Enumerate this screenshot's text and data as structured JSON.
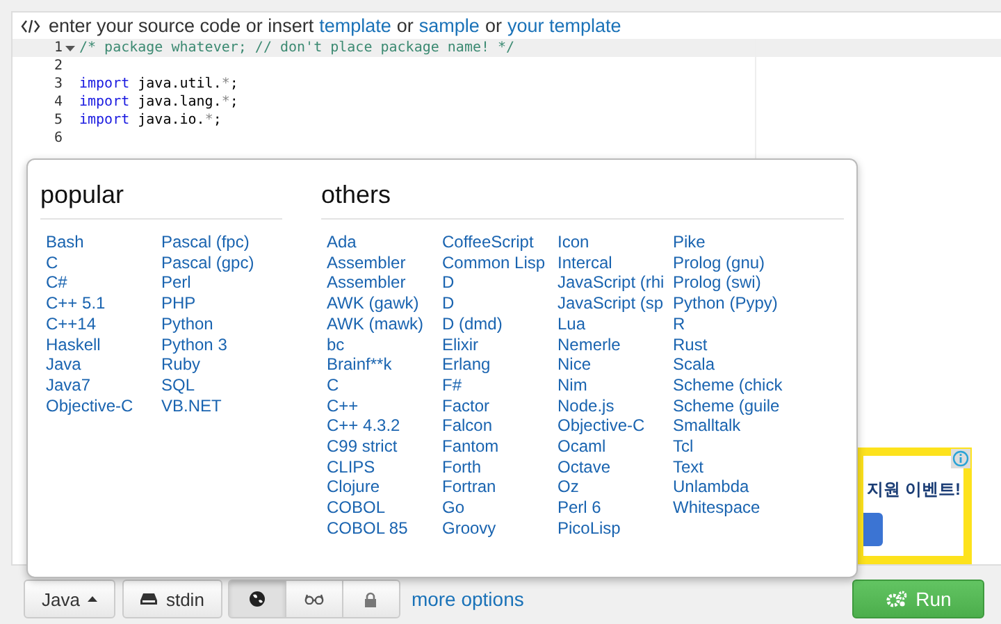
{
  "header": {
    "parts": [
      {
        "kind": "text",
        "text": "enter your source code or insert"
      },
      {
        "kind": "link",
        "text": "template"
      },
      {
        "kind": "text",
        "text": "or"
      },
      {
        "kind": "link",
        "text": "sample"
      },
      {
        "kind": "text",
        "text": "or"
      },
      {
        "kind": "link",
        "text": "your template"
      }
    ]
  },
  "code_lines": [
    {
      "number": "1",
      "foldable": true,
      "active": true,
      "kind": "comment",
      "text": "/* package whatever; // don't place package name! */"
    },
    {
      "number": "2",
      "foldable": false,
      "active": false,
      "kind": "blank"
    },
    {
      "number": "3",
      "foldable": false,
      "active": false,
      "kind": "import",
      "keyword": "import",
      "text": "java.util.",
      "star": "*",
      "end": ";"
    },
    {
      "number": "4",
      "foldable": false,
      "active": false,
      "kind": "import",
      "keyword": "import",
      "text": "java.lang.",
      "star": "*",
      "end": ";"
    },
    {
      "number": "5",
      "foldable": false,
      "active": false,
      "kind": "import",
      "keyword": "import",
      "text": "java.io.",
      "star": "*",
      "end": ";"
    },
    {
      "number": "6",
      "foldable": false,
      "active": false,
      "kind": "blank"
    }
  ],
  "language_menu": {
    "popular": {
      "title": "popular",
      "columns": [
        [
          "Bash",
          "C",
          "C#",
          "C++ 5.1",
          "C++14",
          "Haskell",
          "Java",
          "Java7",
          "Objective-C"
        ],
        [
          "Pascal (fpc)",
          "Pascal (gpc)",
          "Perl",
          "PHP",
          "Python",
          "Python 3",
          "Ruby",
          "SQL",
          "VB.NET"
        ]
      ]
    },
    "others": {
      "title": "others",
      "columns": [
        [
          "Ada",
          "Assembler",
          "Assembler",
          "AWK (gawk)",
          "AWK (mawk)",
          "bc",
          "Brainf**k",
          "C",
          "C++",
          "C++ 4.3.2",
          "C99 strict",
          "CLIPS",
          "Clojure",
          "COBOL",
          "COBOL 85"
        ],
        [
          "CoffeeScript",
          "Common Lisp",
          "D",
          "D",
          "D (dmd)",
          "Elixir",
          "Erlang",
          "F#",
          "Factor",
          "Falcon",
          "Fantom",
          "Forth",
          "Fortran",
          "Go",
          "Groovy"
        ],
        [
          "Icon",
          "Intercal",
          "JavaScript (rhi",
          "JavaScript (sp",
          "Lua",
          "Nemerle",
          "Nice",
          "Nim",
          "Node.js",
          "Objective-C",
          "Ocaml",
          "Octave",
          "Oz",
          "Perl 6",
          "PicoLisp"
        ],
        [
          "Pike",
          "Prolog (gnu)",
          "Prolog (swi)",
          "Python (Pypy)",
          "R",
          "Rust",
          "Scala",
          "Scheme (chick",
          "Scheme (guile",
          "Smalltalk",
          "Tcl",
          "Text",
          "Unlambda",
          "Whitespace"
        ]
      ]
    }
  },
  "ad": {
    "text": "지원 이벤트!"
  },
  "toolbar": {
    "language": "Java",
    "stdin": "stdin",
    "toggles": [
      {
        "kind": "globe",
        "selected": true
      },
      {
        "kind": "glasses",
        "selected": false
      },
      {
        "kind": "lock",
        "selected": false
      }
    ],
    "more_options": "more options",
    "run": "Run"
  }
}
